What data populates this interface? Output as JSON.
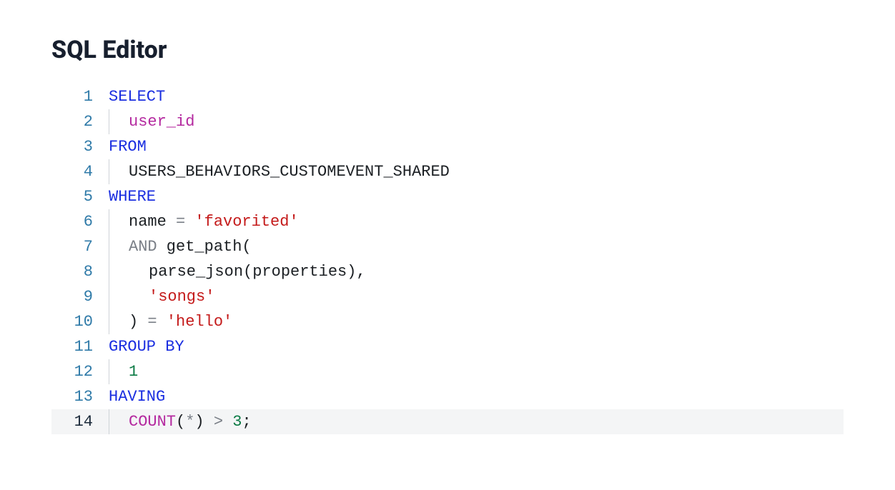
{
  "title": "SQL Editor",
  "editor": {
    "active_line": 14,
    "lines": [
      {
        "num": "1",
        "indent_guides": 0,
        "indent_spacers": 0,
        "tokens": [
          {
            "t": "SELECT",
            "c": "keyword"
          }
        ]
      },
      {
        "num": "2",
        "indent_guides": 1,
        "indent_spacers": 0,
        "tokens": [
          {
            "t": "user_id",
            "c": "identifier"
          }
        ]
      },
      {
        "num": "3",
        "indent_guides": 0,
        "indent_spacers": 0,
        "tokens": [
          {
            "t": "FROM",
            "c": "keyword"
          }
        ]
      },
      {
        "num": "4",
        "indent_guides": 1,
        "indent_spacers": 0,
        "tokens": [
          {
            "t": "USERS_BEHAVIORS_CUSTOMEVENT_SHARED",
            "c": "default"
          }
        ]
      },
      {
        "num": "5",
        "indent_guides": 0,
        "indent_spacers": 0,
        "tokens": [
          {
            "t": "WHERE",
            "c": "keyword"
          }
        ]
      },
      {
        "num": "6",
        "indent_guides": 1,
        "indent_spacers": 0,
        "tokens": [
          {
            "t": "name",
            "c": "default"
          },
          {
            "t": " ",
            "c": "default"
          },
          {
            "t": "=",
            "c": "operator"
          },
          {
            "t": " ",
            "c": "default"
          },
          {
            "t": "'favorited'",
            "c": "string"
          }
        ]
      },
      {
        "num": "7",
        "indent_guides": 1,
        "indent_spacers": 0,
        "tokens": [
          {
            "t": "AND",
            "c": "operator"
          },
          {
            "t": " get_path(",
            "c": "default"
          }
        ]
      },
      {
        "num": "8",
        "indent_guides": 1,
        "indent_spacers": 1,
        "tokens": [
          {
            "t": "parse_json(properties),",
            "c": "default"
          }
        ]
      },
      {
        "num": "9",
        "indent_guides": 1,
        "indent_spacers": 1,
        "tokens": [
          {
            "t": "'songs'",
            "c": "string"
          }
        ]
      },
      {
        "num": "10",
        "indent_guides": 1,
        "indent_spacers": 0,
        "tokens": [
          {
            "t": ") ",
            "c": "default"
          },
          {
            "t": "=",
            "c": "operator"
          },
          {
            "t": " ",
            "c": "default"
          },
          {
            "t": "'hello'",
            "c": "string"
          }
        ]
      },
      {
        "num": "11",
        "indent_guides": 0,
        "indent_spacers": 0,
        "tokens": [
          {
            "t": "GROUP BY",
            "c": "keyword"
          }
        ]
      },
      {
        "num": "12",
        "indent_guides": 1,
        "indent_spacers": 0,
        "tokens": [
          {
            "t": "1",
            "c": "number"
          }
        ]
      },
      {
        "num": "13",
        "indent_guides": 0,
        "indent_spacers": 0,
        "tokens": [
          {
            "t": "HAVING",
            "c": "keyword"
          }
        ]
      },
      {
        "num": "14",
        "indent_guides": 1,
        "indent_spacers": 0,
        "tokens": [
          {
            "t": "COUNT",
            "c": "identifier"
          },
          {
            "t": "(",
            "c": "punct"
          },
          {
            "t": "*",
            "c": "operator"
          },
          {
            "t": ") ",
            "c": "punct"
          },
          {
            "t": ">",
            "c": "operator"
          },
          {
            "t": " ",
            "c": "default"
          },
          {
            "t": "3",
            "c": "number"
          },
          {
            "t": ";",
            "c": "punct"
          }
        ]
      }
    ]
  }
}
